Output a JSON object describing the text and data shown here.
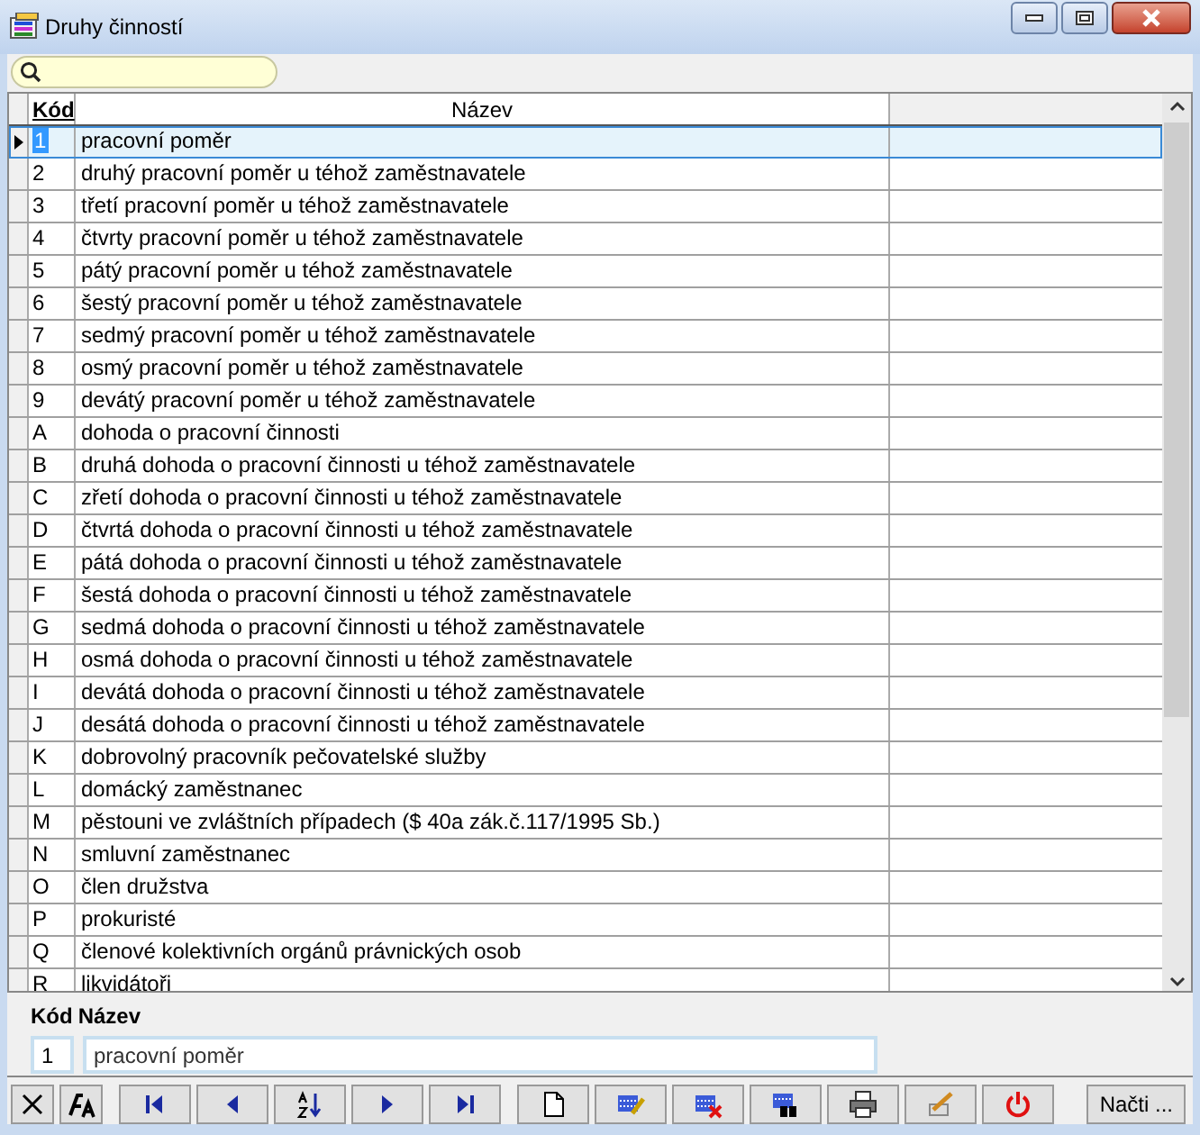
{
  "window": {
    "title": "Druhy činností"
  },
  "table": {
    "columns": [
      "Kód",
      "Název"
    ],
    "rows": [
      {
        "code": "1",
        "name": "pracovní poměr",
        "selected": true
      },
      {
        "code": "2",
        "name": "druhý pracovní poměr u téhož zaměstnavatele",
        "selected": false
      },
      {
        "code": "3",
        "name": "třetí pracovní poměr u téhož zaměstnavatele",
        "selected": false
      },
      {
        "code": "4",
        "name": "čtvrty pracovní poměr u téhož zaměstnavatele",
        "selected": false
      },
      {
        "code": "5",
        "name": "pátý pracovní poměr u téhož zaměstnavatele",
        "selected": false
      },
      {
        "code": "6",
        "name": "šestý pracovní poměr u téhož zaměstnavatele",
        "selected": false
      },
      {
        "code": "7",
        "name": "sedmý pracovní poměr u téhož zaměstnavatele",
        "selected": false
      },
      {
        "code": "8",
        "name": "osmý pracovní poměr u téhož zaměstnavatele",
        "selected": false
      },
      {
        "code": "9",
        "name": "devátý pracovní poměr u téhož zaměstnavatele",
        "selected": false
      },
      {
        "code": "A",
        "name": "dohoda o pracovní činnosti",
        "selected": false
      },
      {
        "code": "B",
        "name": "druhá dohoda o pracovní činnosti u téhož zaměstnavatele",
        "selected": false
      },
      {
        "code": "C",
        "name": "zřetí dohoda o pracovní činnosti u téhož zaměstnavatele",
        "selected": false
      },
      {
        "code": "D",
        "name": "čtvrtá dohoda o pracovní činnosti u téhož zaměstnavatele",
        "selected": false
      },
      {
        "code": "E",
        "name": "pátá dohoda o pracovní činnosti u téhož zaměstnavatele",
        "selected": false
      },
      {
        "code": "F",
        "name": "šestá dohoda o pracovní činnosti u téhož zaměstnavatele",
        "selected": false
      },
      {
        "code": "G",
        "name": "sedmá dohoda o pracovní činnosti u téhož zaměstnavatele",
        "selected": false
      },
      {
        "code": "H",
        "name": "osmá dohoda o pracovní činnosti u téhož zaměstnavatele",
        "selected": false
      },
      {
        "code": "I",
        "name": "devátá dohoda o pracovní činnosti u téhož zaměstnavatele",
        "selected": false
      },
      {
        "code": "J",
        "name": "desátá dohoda o pracovní činnosti u téhož zaměstnavatele",
        "selected": false
      },
      {
        "code": "K",
        "name": "dobrovolný pracovník pečovatelské služby",
        "selected": false
      },
      {
        "code": "L",
        "name": "domácký zaměstnanec",
        "selected": false
      },
      {
        "code": "M",
        "name": "pěstouni ve zvláštních případech ($ 40a zák.č.117/1995 Sb.)",
        "selected": false
      },
      {
        "code": "N",
        "name": "smluvní zaměstnanec",
        "selected": false
      },
      {
        "code": "O",
        "name": "člen družstva",
        "selected": false
      },
      {
        "code": "P",
        "name": "prokuristé",
        "selected": false
      },
      {
        "code": "Q",
        "name": "členové kolektivních orgánů právnických osob",
        "selected": false
      },
      {
        "code": "R",
        "name": "likvidátoři",
        "selected": false
      }
    ]
  },
  "detail": {
    "code_label": "Kód",
    "name_label": "Název",
    "code": "1",
    "name": "pracovní poměr"
  },
  "toolbar": [
    {
      "kind": "clear"
    },
    {
      "kind": "font"
    },
    {
      "kind": "first"
    },
    {
      "kind": "prev"
    },
    {
      "kind": "sort"
    },
    {
      "kind": "next"
    },
    {
      "kind": "last"
    },
    {
      "kind": "new"
    },
    {
      "kind": "edit"
    },
    {
      "kind": "delete"
    },
    {
      "kind": "find"
    },
    {
      "kind": "print"
    },
    {
      "kind": "tools"
    },
    {
      "kind": "power"
    },
    {
      "kind": "text",
      "label": "Načti ..."
    }
  ]
}
